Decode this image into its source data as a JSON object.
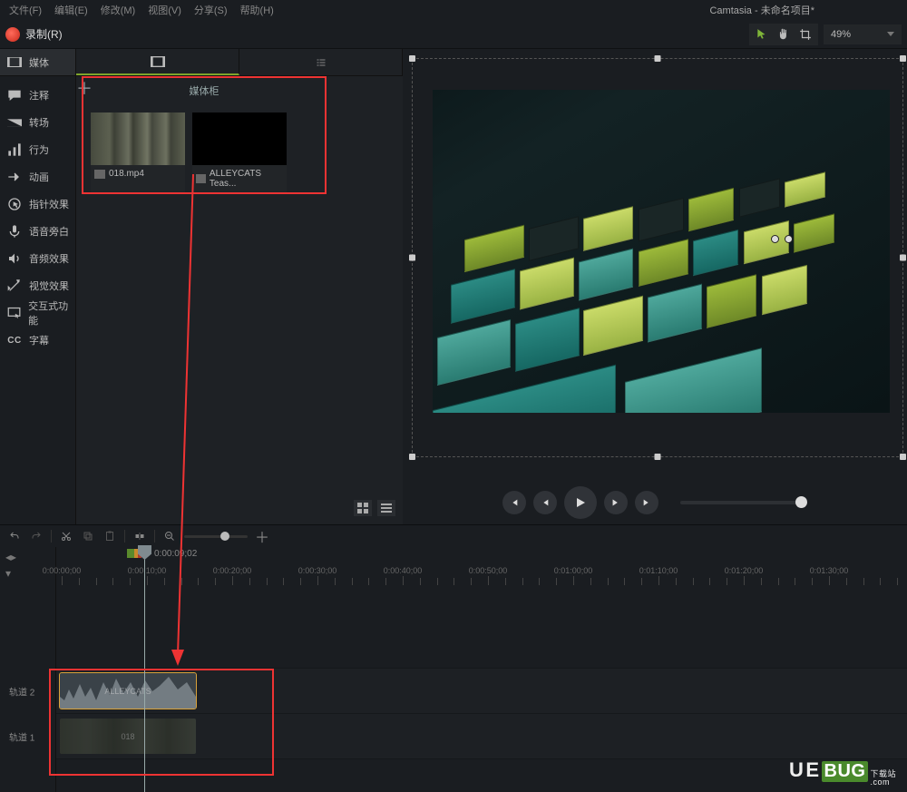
{
  "app_title": "Camtasia - 未命名项目*",
  "menu": {
    "file": "文件(F)",
    "edit": "编辑(E)",
    "modify": "修改(M)",
    "view": "视图(V)",
    "share": "分享(S)",
    "help": "帮助(H)"
  },
  "record_label": "录制(R)",
  "zoom_value": "49%",
  "sidebar": {
    "media": "媒体",
    "annotations": "注释",
    "transitions": "转场",
    "behaviors": "行为",
    "animations": "动画",
    "cursor": "指针效果",
    "voice": "语音旁白",
    "audio": "音频效果",
    "visual": "视觉效果",
    "interactive": "交互式功能",
    "captions": "字幕",
    "cc_abbrev": "CC"
  },
  "media_bin": {
    "title": "媒体柜",
    "clips": [
      {
        "name": "018.mp4"
      },
      {
        "name": "ALLEYCATS Teas..."
      }
    ]
  },
  "playhead_time": "0:00:09;02",
  "ruler_labels": [
    "0:00:00;00",
    "0:00:10;00",
    "0:00:20;00",
    "0:00:30;00",
    "0:00:40;00",
    "0:00:50;00",
    "0:01:00;00",
    "0:01:10;00",
    "0:01:20;00",
    "0:01:30;00"
  ],
  "tracks": {
    "t2": "轨道 2",
    "t1": "轨道 1",
    "clip2_name": "ALLEYCATS",
    "clip1_name": "018"
  },
  "watermark": {
    "u": "U",
    "e": "E",
    "bug": "BUG",
    "suffix": "下载站",
    "com": ".com"
  }
}
